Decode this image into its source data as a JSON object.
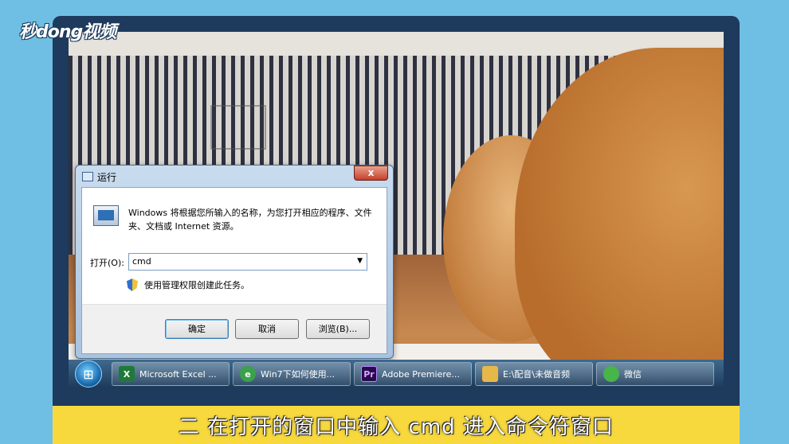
{
  "brand": {
    "logo_text": "秒dong视频"
  },
  "dialog": {
    "title": "运行",
    "close_label": "x",
    "description": "Windows 将根据您所输入的名称，为您打开相应的程序、文件夹、文档或 Internet 资源。",
    "open_label": "打开(O):",
    "input_value": "cmd",
    "admin_note": "使用管理权限创建此任务。",
    "ok_label": "确定",
    "cancel_label": "取消",
    "browse_label": "浏览(B)..."
  },
  "taskbar": {
    "items": [
      {
        "label": "Microsoft Excel ...",
        "icon": "excel-icon",
        "icon_text": "X",
        "color": "#1f7a3a"
      },
      {
        "label": "Win7下如何使用...",
        "icon": "ie-icon",
        "icon_text": "e",
        "color": "#3aa24a"
      },
      {
        "label": "Adobe Premiere...",
        "icon": "premiere-icon",
        "icon_text": "Pr",
        "color": "#2a0a4e"
      },
      {
        "label": "E:\\配音\\未做音频",
        "icon": "folder-icon",
        "icon_text": "",
        "color": "#e6b84a"
      },
      {
        "label": "微信",
        "icon": "wechat-icon",
        "icon_text": "",
        "color": "#47b548"
      }
    ]
  },
  "caption": {
    "text": "二 在打开的窗口中输入 cmd 进入命令符窗口"
  }
}
